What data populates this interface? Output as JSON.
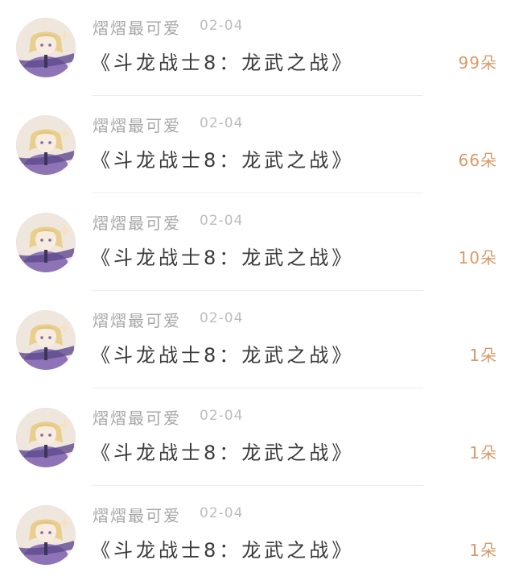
{
  "posts": [
    {
      "username": "熠熠最可爱",
      "date": "02-04",
      "title": "《斗龙战士8：龙武之战》",
      "count": "99朵"
    },
    {
      "username": "熠熠最可爱",
      "date": "02-04",
      "title": "《斗龙战士8：龙武之战》",
      "count": "66朵"
    },
    {
      "username": "熠熠最可爱",
      "date": "02-04",
      "title": "《斗龙战士8：龙武之战》",
      "count": "10朵"
    },
    {
      "username": "熠熠最可爱",
      "date": "02-04",
      "title": "《斗龙战士8：龙武之战》",
      "count": "1朵"
    },
    {
      "username": "熠熠最可爱",
      "date": "02-04",
      "title": "《斗龙战士8：龙武之战》",
      "count": "1朵"
    },
    {
      "username": "熠熠最可爱",
      "date": "02-04",
      "title": "《斗龙战士8：龙武之战》",
      "count": "1朵"
    }
  ],
  "colors": {
    "username": "#a7a7a7",
    "date": "#bdbdbd",
    "title": "#3a3a3a",
    "count": "#d89a68",
    "divider": "#ececec"
  },
  "icons": {
    "avatar": "anime-avatar"
  }
}
